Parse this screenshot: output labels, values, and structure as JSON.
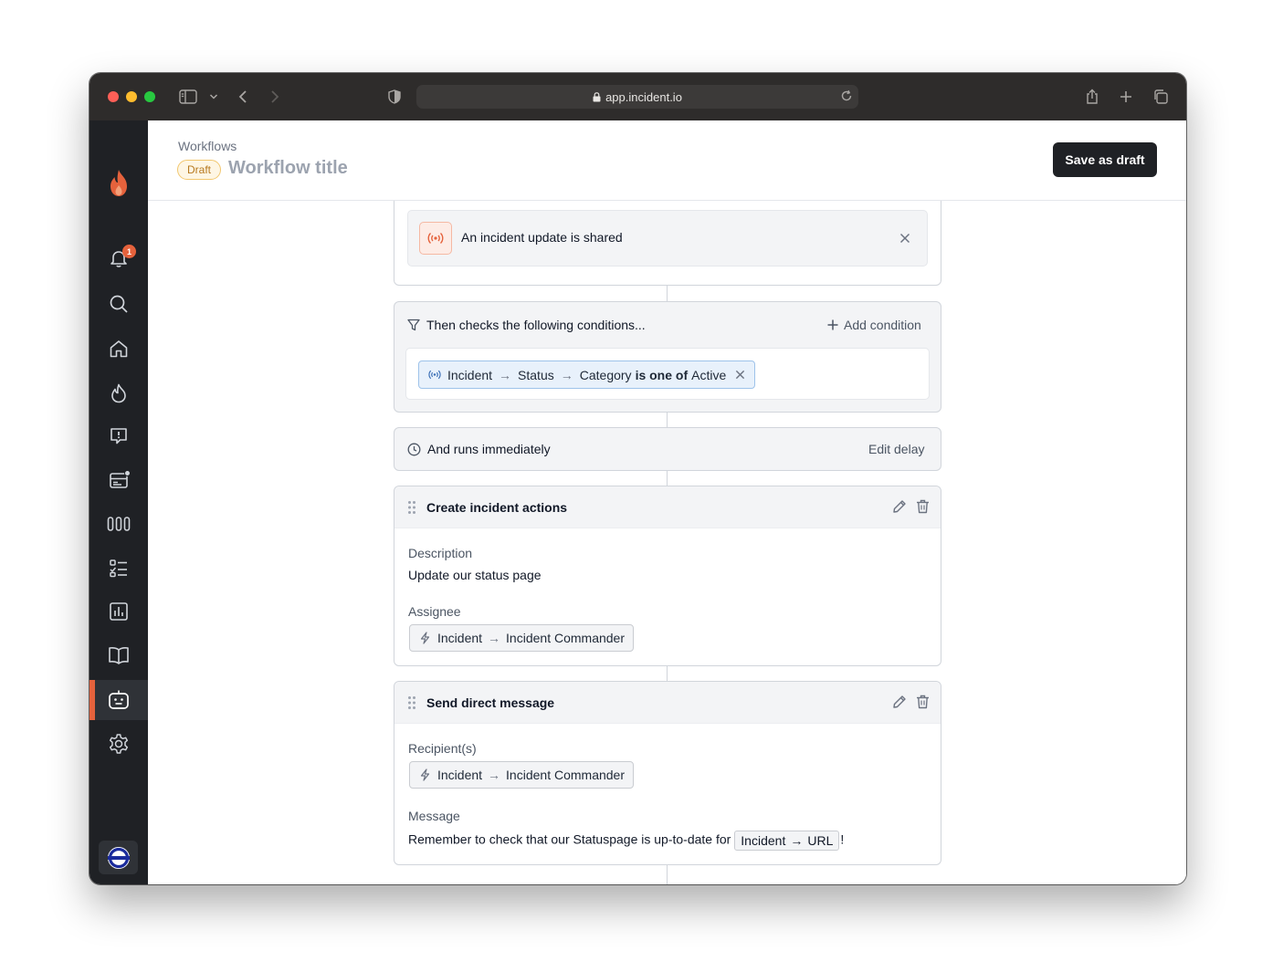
{
  "browser": {
    "url": "app.incident.io"
  },
  "rail": {
    "notification_count": "1"
  },
  "header": {
    "breadcrumb": "Workflows",
    "status_pill": "Draft",
    "title": "Workflow title",
    "save_label": "Save as draft"
  },
  "trigger": {
    "label": "An incident update is shared"
  },
  "conditions": {
    "heading": "Then checks the following conditions...",
    "add_label": "Add condition",
    "chip": {
      "part1": "Incident",
      "arrow1": "→",
      "part2": "Status",
      "arrow2": "→",
      "part3": "Category",
      "operator": "is one of",
      "value": "Active"
    }
  },
  "delay": {
    "label": "And runs immediately",
    "edit_label": "Edit delay"
  },
  "actions": [
    {
      "title": "Create incident actions",
      "field1_label": "Description",
      "field1_value": "Update our status page",
      "field2_label": "Assignee",
      "chip_part1": "Incident",
      "chip_arrow": "→",
      "chip_part2": "Incident Commander"
    },
    {
      "title": "Send direct message",
      "field1_label": "Recipient(s)",
      "chip_part1": "Incident",
      "chip_arrow": "→",
      "chip_part2": "Incident Commander",
      "field2_label": "Message",
      "message_prefix": "Remember to check that our Statuspage is up-to-date for",
      "message_var_part1": "Incident",
      "message_var_arrow": "→",
      "message_var_part2": "URL",
      "message_suffix": "!"
    }
  ],
  "colors": {
    "brand_accent": "#e5623c",
    "rail_background": "#1f2125",
    "condition_chip_bg": "#e8f1fb",
    "draft_pill_text": "#b7791f"
  },
  "icons": {
    "rail": [
      "flame-logo-icon",
      "bell-icon",
      "search-icon",
      "home-icon",
      "incidents-flame-icon",
      "alert-message-icon",
      "status-page-icon",
      "on-call-icon",
      "checklist-icon",
      "insights-icon",
      "catalog-book-icon",
      "workflows-robot-icon",
      "settings-gear-icon"
    ],
    "trigger": "broadcast-icon",
    "conditions": "filter-icon",
    "delay": "clock-icon",
    "actions": [
      "drag-handle-icon",
      "pencil-icon",
      "trash-icon"
    ],
    "variable": "lightning-icon"
  }
}
